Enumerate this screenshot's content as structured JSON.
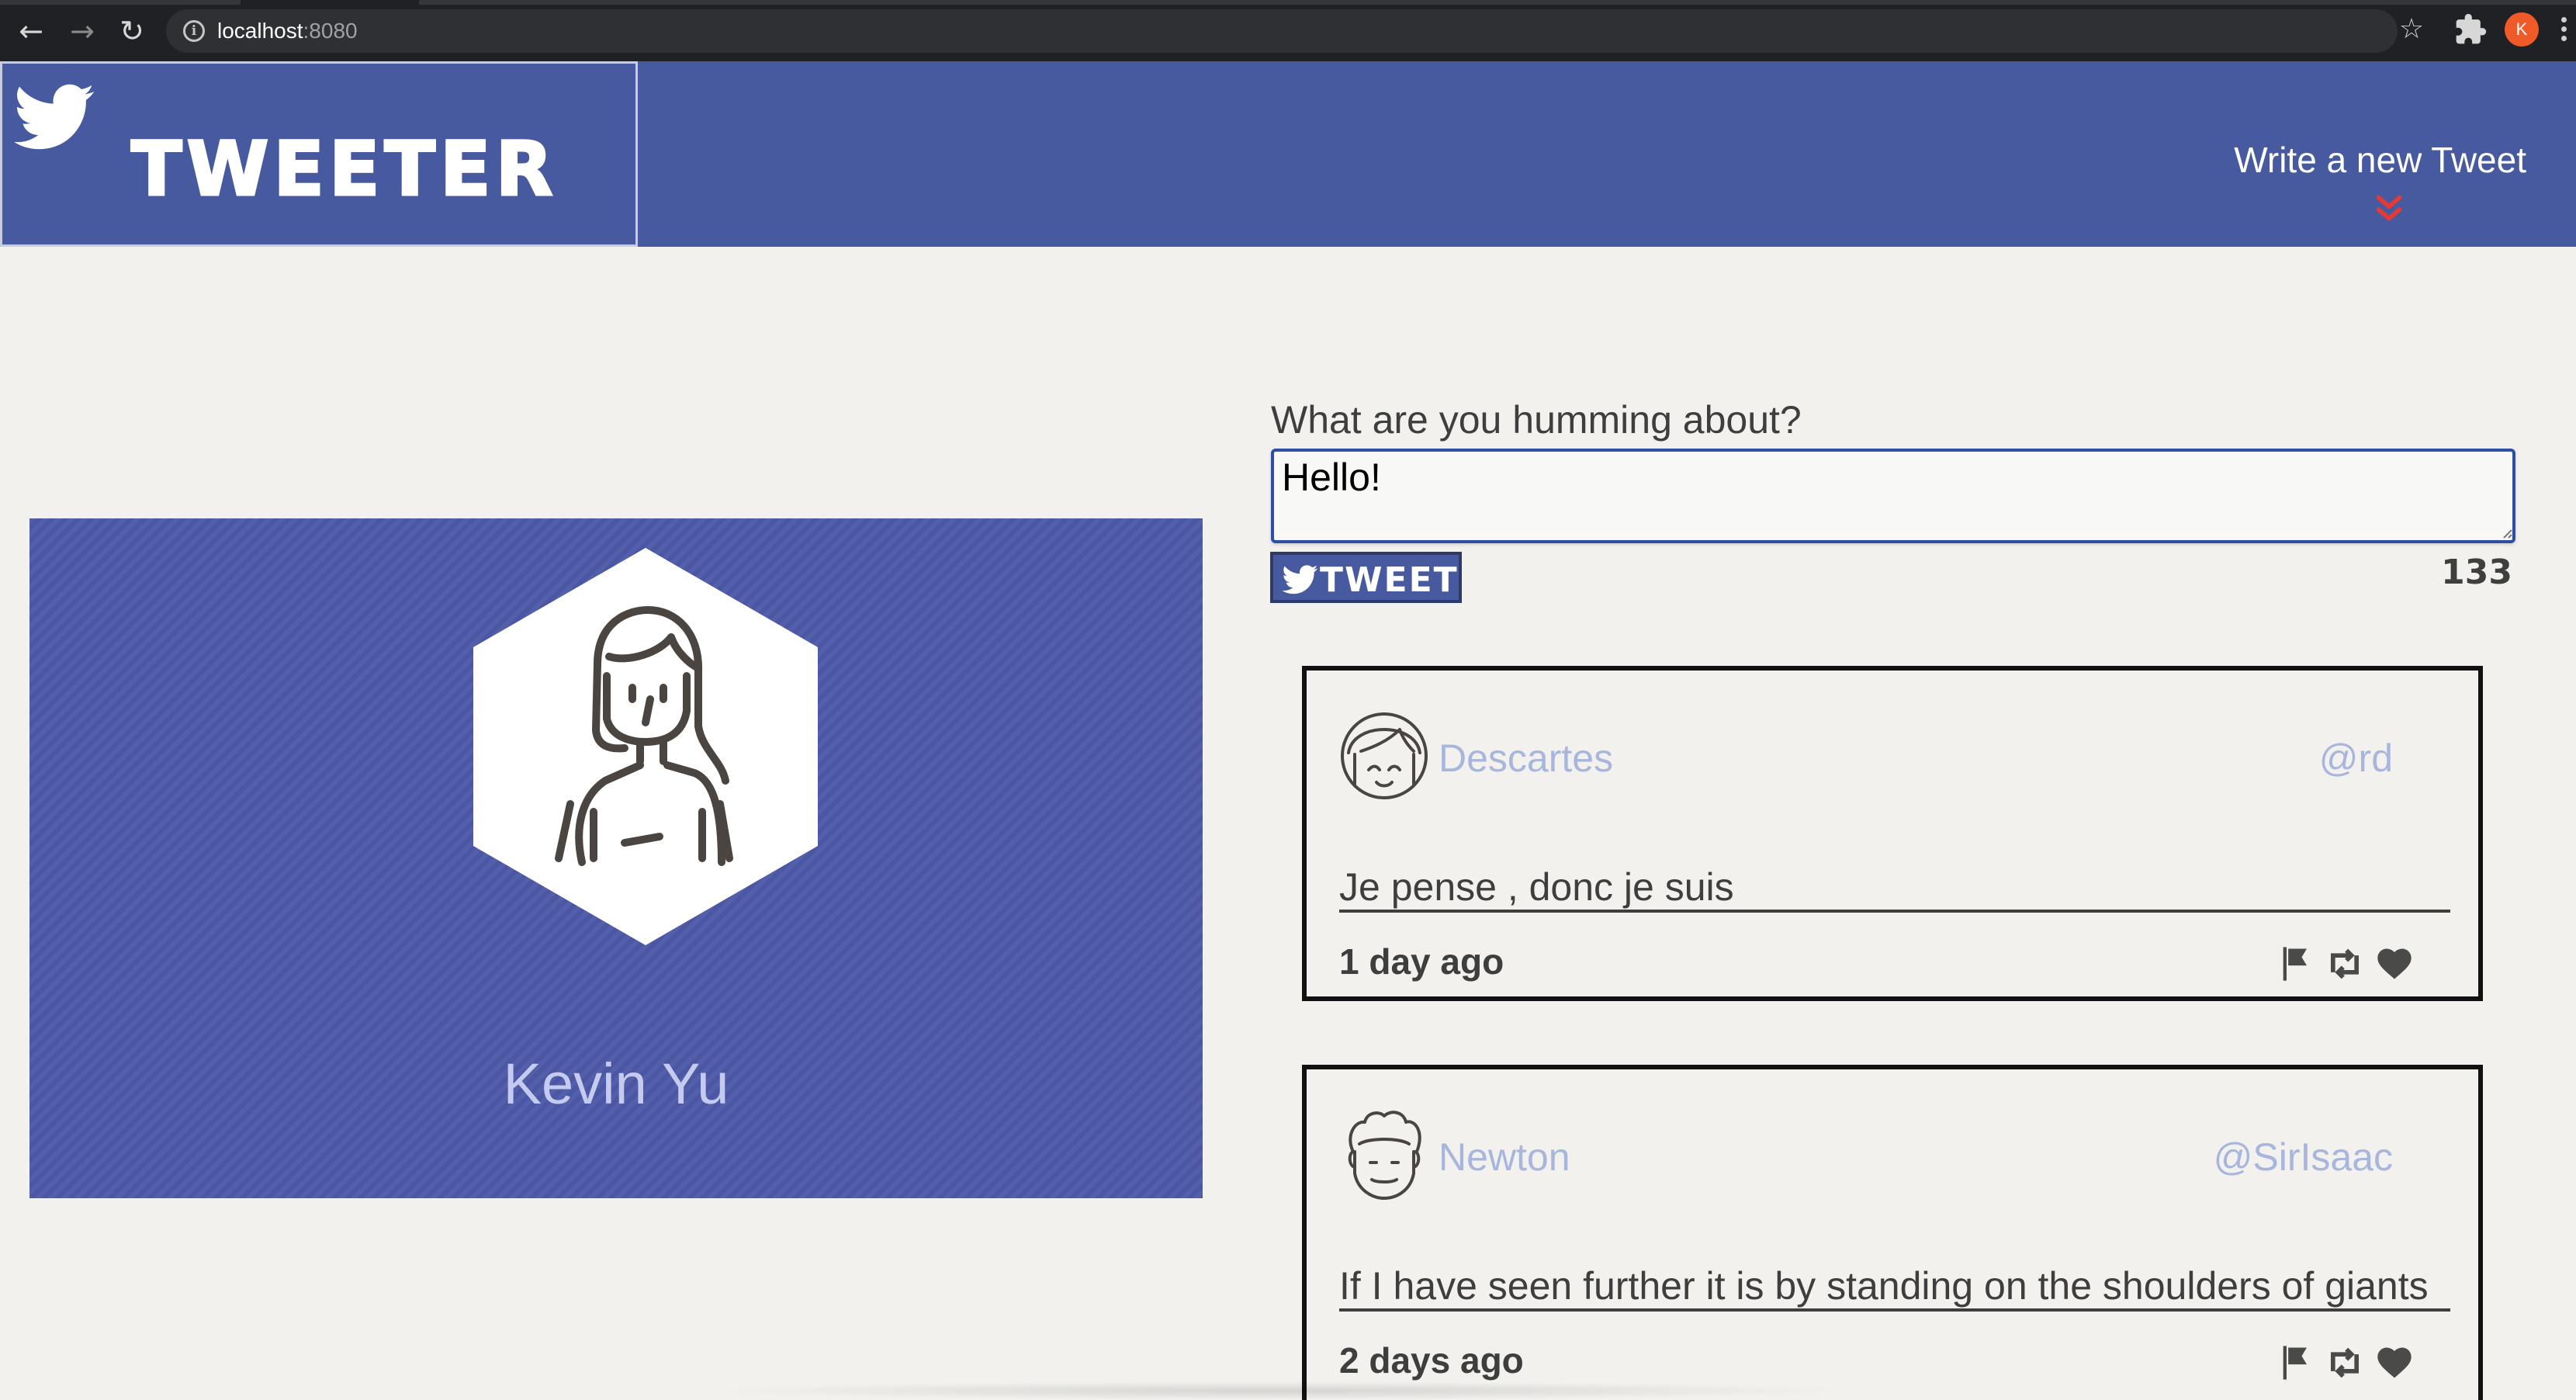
{
  "browser": {
    "url_host": "localhost",
    "url_port": ":8080",
    "profile_initial": "K",
    "icons": {
      "back": "arrow-left-icon",
      "forward": "arrow-right-icon",
      "reload": "reload-icon",
      "info": "info-icon",
      "bookmark": "star-icon",
      "extensions": "puzzle-icon",
      "menu": "kebab-menu-icon"
    }
  },
  "header": {
    "title": "TWEETER",
    "compose_link": "Write a new Tweet",
    "colors": {
      "background": "#475a9f",
      "accent": "#e53935"
    }
  },
  "profile": {
    "name": "Kevin Yu",
    "card_color": "#4d5aa8"
  },
  "compose": {
    "label": "What are you humming about?",
    "text": "Hello! ",
    "button_label": "TWEET",
    "counter": "133"
  },
  "tweets": [
    {
      "name": "Descartes",
      "handle": "@rd",
      "content": "Je pense , donc je suis",
      "time": "1 day ago"
    },
    {
      "name": "Newton",
      "handle": "@SirIsaac",
      "content": "If I have seen further it is by standing on the shoulders of giants",
      "time": "2 days ago"
    }
  ]
}
